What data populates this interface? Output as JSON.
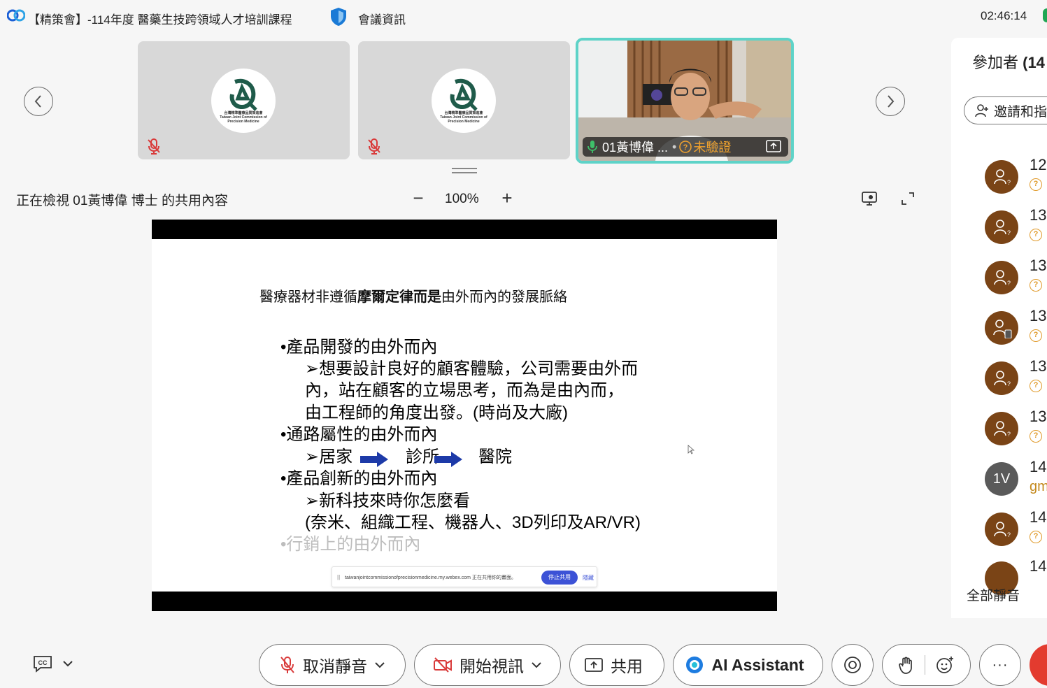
{
  "titlebar": {
    "meeting_title": "【精策會】-114年度 醫藥生技跨領域人才培訓課程",
    "meeting_info": "會議資訊",
    "clock": "02:46:14"
  },
  "tiles": [
    {
      "org_line1": "台灣精準醫療品質策進會",
      "org_line2": "Taiwan Joint Commission of",
      "org_line3": "Precision Medicine"
    },
    {
      "org_line1": "台灣精準醫療品質策進會",
      "org_line2": "Taiwan Joint Commission of",
      "org_line3": "Precision Medicine"
    }
  ],
  "active_tile": {
    "name": "01黃博偉 ...",
    "status": "未驗證"
  },
  "share_view": {
    "viewing_text": "正在檢視 01黃博偉 博士 的共用內容",
    "zoom_minus": "−",
    "zoom_level": "100%",
    "zoom_plus": "+"
  },
  "slide": {
    "heading_pre": "醫療器材非遵循",
    "heading_bold": "摩爾定律而是",
    "heading_post": "由外而內的發展脈絡",
    "lines": [
      "•產品開發的由外而內",
      "➢想要設計良好的顧客體驗，公司需要由外而",
      "內，站在顧客的立場思考，而為是由內而，",
      "由工程師的角度出發。(時尚及大廠)",
      "•通路屬性的由外而內",
      "➢居家",
      "診所",
      "醫院",
      "•產品創新的由外而內",
      "➢新科技來時你怎麼看",
      "(奈米、組織工程、機器人、3D列印及AR/VR)",
      "•行銷上的由外而內"
    ],
    "banner_bar": "||",
    "banner_text": "taiwanjointcommissionofprecisionmedicine.my.webex.com 正在共用你的畫面。",
    "banner_stop": "停止共用",
    "banner_hide": "隱藏"
  },
  "participants": {
    "title_prefix": "參加者 ",
    "title_count": "(14",
    "invite_label": "邀請和指",
    "rows": [
      {
        "id": "12",
        "type": "unverified"
      },
      {
        "id": "13",
        "type": "unverified"
      },
      {
        "id": "13",
        "type": "unverified"
      },
      {
        "id": "13",
        "type": "unverified-mobile"
      },
      {
        "id": "13",
        "type": "unverified"
      },
      {
        "id": "13",
        "type": "unverified"
      },
      {
        "id": "14",
        "type": "initials",
        "initials": "1V",
        "sub": "gm"
      },
      {
        "id": "14",
        "type": "unverified"
      },
      {
        "id": "14",
        "type": "unverified"
      }
    ],
    "unverified_glyph": "?",
    "mute_all": "全部靜音"
  },
  "toolbar": {
    "unmute_label": "取消靜音",
    "video_label": "開始視訊",
    "share_label": "共用",
    "ai_label": "AI Assistant",
    "more_label": "···"
  },
  "colors": {
    "accent_teal": "#5ed3c8",
    "warning_orange": "#f0a22e",
    "avatar_brown": "#7a4416",
    "end_red": "#e33b2f",
    "mute_red": "#d93a3a",
    "arrow_blue": "#1d3aa8"
  }
}
